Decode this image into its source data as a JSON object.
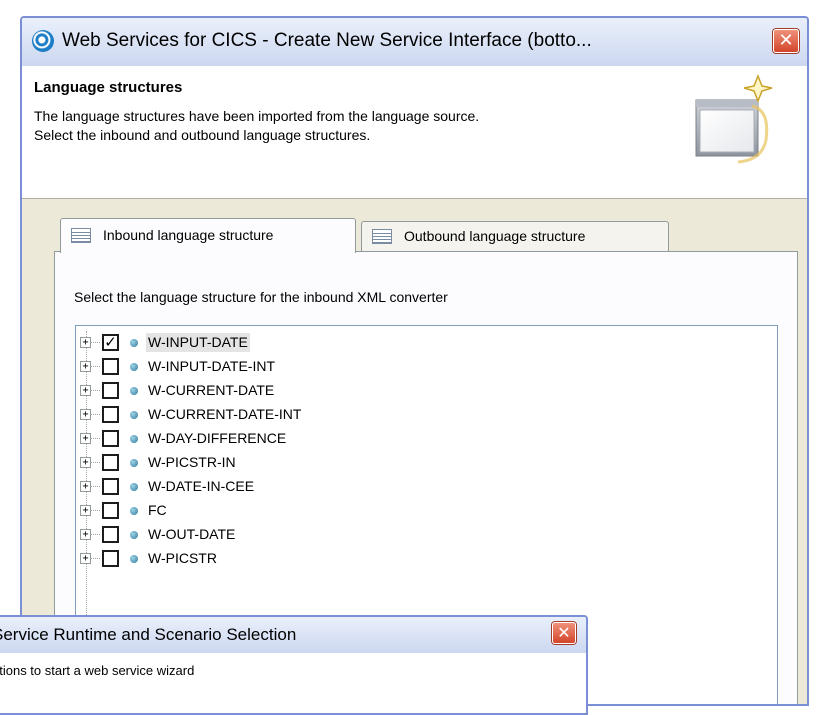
{
  "main_window": {
    "title": "Web Services for CICS - Create New Service Interface (botto...",
    "close_label": "✕",
    "banner": {
      "heading": "Language structures",
      "description_line1": "The language structures have been imported from the language source.",
      "description_line2": "Select the inbound and outbound language structures."
    },
    "tabs": [
      {
        "label": "Inbound language structure",
        "selected": true
      },
      {
        "label": "Outbound language structure",
        "selected": false
      }
    ],
    "panel_label": "Select the language structure for the inbound XML converter",
    "tree": {
      "items": [
        {
          "label": "W-INPUT-DATE",
          "checked": true,
          "selected": true,
          "expander": "+",
          "check_mark": "✓"
        },
        {
          "label": "W-INPUT-DATE-INT",
          "checked": false,
          "selected": false,
          "expander": "+",
          "check_mark": ""
        },
        {
          "label": "W-CURRENT-DATE",
          "checked": false,
          "selected": false,
          "expander": "+",
          "check_mark": ""
        },
        {
          "label": "W-CURRENT-DATE-INT",
          "checked": false,
          "selected": false,
          "expander": "+",
          "check_mark": ""
        },
        {
          "label": "W-DAY-DIFFERENCE",
          "checked": false,
          "selected": false,
          "expander": "+",
          "check_mark": ""
        },
        {
          "label": "W-PICSTR-IN",
          "checked": false,
          "selected": false,
          "expander": "+",
          "check_mark": ""
        },
        {
          "label": "W-DATE-IN-CEE",
          "checked": false,
          "selected": false,
          "expander": "+",
          "check_mark": ""
        },
        {
          "label": "FC",
          "checked": false,
          "selected": false,
          "expander": "+",
          "check_mark": ""
        },
        {
          "label": "W-OUT-DATE",
          "checked": false,
          "selected": false,
          "expander": "+",
          "check_mark": ""
        },
        {
          "label": "W-PICSTR",
          "checked": false,
          "selected": false,
          "expander": "+",
          "check_mark": ""
        }
      ]
    }
  },
  "second_window": {
    "title": " Service Runtime and Scenario Selection",
    "close_label": "✕",
    "subtitle": "ptions to start a web service wizard"
  },
  "colors": {
    "window_frame": "#7b8fd6",
    "title_bar": "#ccd7f0",
    "dialog_face": "#ece9d8",
    "close_button": "#d2452a",
    "tree_dot": "#2b7b9c"
  },
  "icons": {
    "app_icon": "cics-web-service-icon",
    "banner_graphic": "wizard-window-star-icon",
    "tab_icon": "table-structure-icon"
  }
}
